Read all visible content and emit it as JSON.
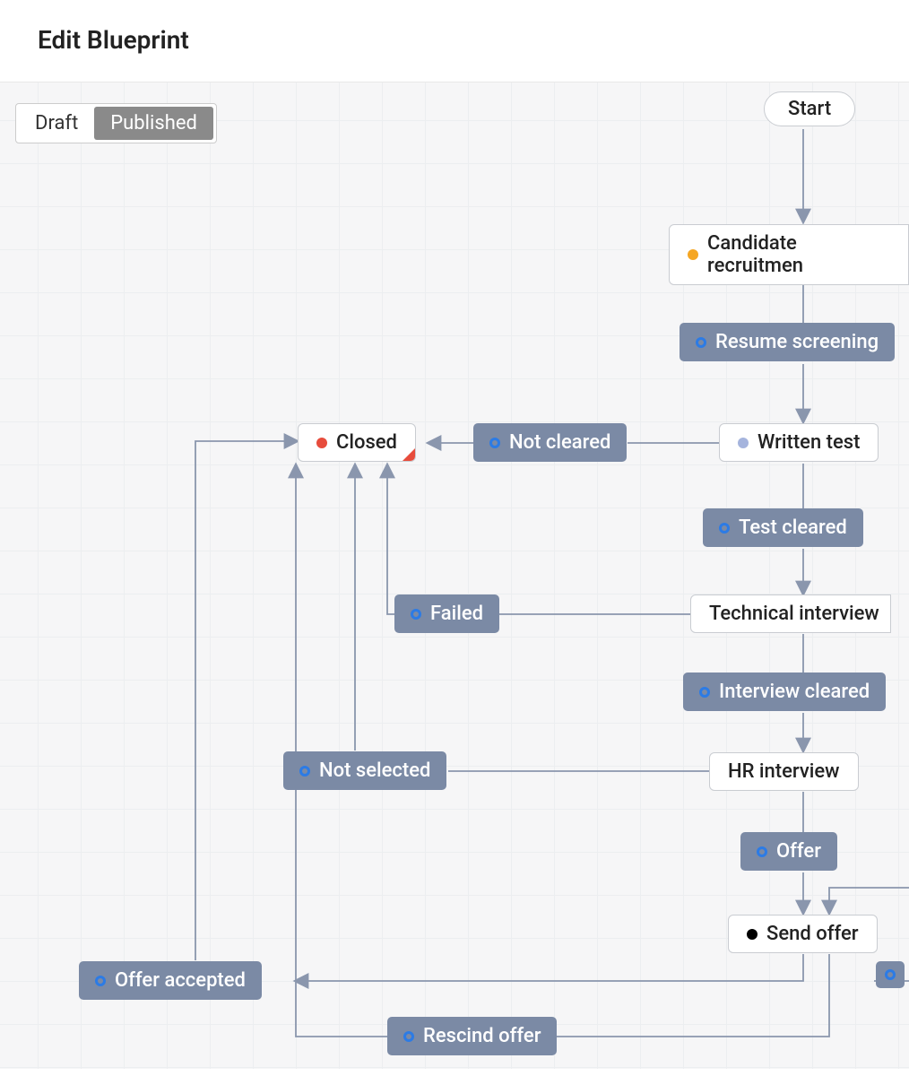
{
  "header": {
    "title": "Edit Blueprint"
  },
  "toggle": {
    "options": [
      "Draft",
      "Published"
    ],
    "active": "Published"
  },
  "states": {
    "start": {
      "label": "Start"
    },
    "candidate_recruitment": {
      "label": "Candidate recruitmen",
      "dot": "orange"
    },
    "written_test": {
      "label": "Written test",
      "dot": "lightblue"
    },
    "technical_interview": {
      "label": "Technical interview"
    },
    "hr_interview": {
      "label": "HR interview"
    },
    "send_offer": {
      "label": "Send offer",
      "dot": "black"
    },
    "closed": {
      "label": "Closed",
      "dot": "red"
    }
  },
  "transitions": {
    "resume_screening": {
      "label": "Resume screening"
    },
    "not_cleared": {
      "label": "Not cleared"
    },
    "test_cleared": {
      "label": "Test cleared"
    },
    "failed": {
      "label": "Failed"
    },
    "interview_cleared": {
      "label": "Interview cleared"
    },
    "not_selected": {
      "label": "Not selected"
    },
    "offer": {
      "label": "Offer"
    },
    "offer_accepted": {
      "label": "Offer accepted"
    },
    "rescind_offer": {
      "label": "Rescind offer"
    }
  },
  "colors": {
    "transition_bg": "#7b8aa5",
    "connector": "#8a96ad",
    "state_border": "#c9ccd1",
    "canvas_bg": "#f6f6f7",
    "grid": "#eceef0"
  }
}
